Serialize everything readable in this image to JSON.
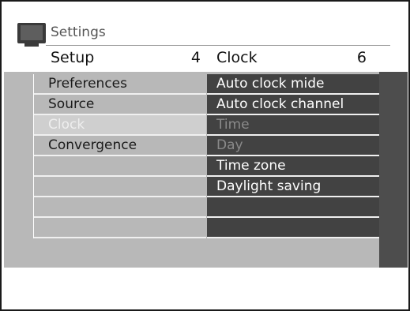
{
  "breadcrumb": "Settings",
  "left_header": {
    "title": "Setup",
    "count": "4"
  },
  "right_header": {
    "title": "Clock",
    "count": "6"
  },
  "left_menu": [
    {
      "label": "Preferences",
      "state": "normal"
    },
    {
      "label": "Source",
      "state": "normal"
    },
    {
      "label": "Clock",
      "state": "selected"
    },
    {
      "label": "Convergence",
      "state": "normal"
    },
    {
      "label": "",
      "state": "empty"
    },
    {
      "label": "",
      "state": "empty"
    },
    {
      "label": "",
      "state": "empty"
    },
    {
      "label": "",
      "state": "empty"
    }
  ],
  "right_menu": [
    {
      "label": "Auto clock mide",
      "state": "normal"
    },
    {
      "label": "Auto clock channel",
      "state": "normal"
    },
    {
      "label": "Time",
      "state": "disabled"
    },
    {
      "label": "Day",
      "state": "disabled"
    },
    {
      "label": "Time zone",
      "state": "normal"
    },
    {
      "label": "Daylight saving",
      "state": "normal"
    },
    {
      "label": "",
      "state": "empty"
    },
    {
      "label": "",
      "state": "empty"
    }
  ],
  "colors": {
    "panel_bg": "#b8b8b8",
    "right_bg": "#424242",
    "selected_bg": "#cfcfcf"
  },
  "icons": {
    "tv": "tv-icon"
  }
}
